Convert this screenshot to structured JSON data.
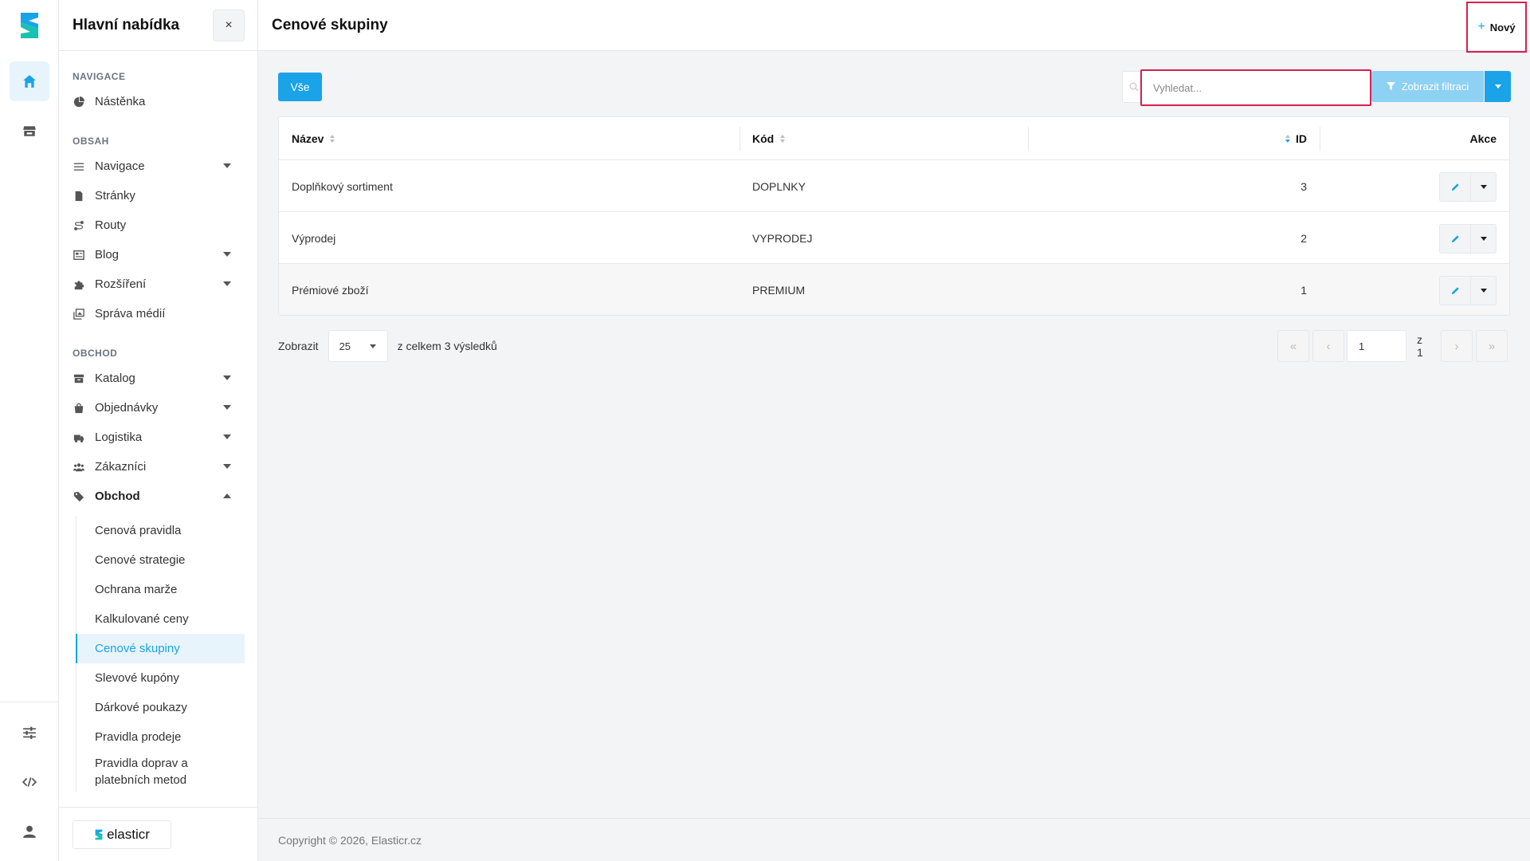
{
  "sidebar": {
    "title": "Hlavní nabídka",
    "close_label": "×",
    "sections": {
      "navigace": "NAVIGACE",
      "obsah": "OBSAH",
      "obchod": "OBCHOD"
    },
    "items": {
      "nastenka": "Nástěnka",
      "navigace": "Navigace",
      "stranky": "Stránky",
      "routy": "Routy",
      "blog": "Blog",
      "rozsireni": "Rozšíření",
      "sprava_medii": "Správa médií",
      "katalog": "Katalog",
      "objednavky": "Objednávky",
      "logistika": "Logistika",
      "zakaznici": "Zákazníci",
      "obchod": "Obchod"
    },
    "submenu": [
      "Cenová pravidla",
      "Cenové strategie",
      "Ochrana marže",
      "Kalkulované ceny",
      "Cenové skupiny",
      "Slevové kupóny",
      "Dárkové poukazy",
      "Pravidla prodeje",
      "Pravidla doprav a platebních metod"
    ],
    "brand": "elasticr"
  },
  "header": {
    "title": "Cenové skupiny",
    "new_label": "Nový",
    "new_icon": "+"
  },
  "toolbar": {
    "all_label": "Vše",
    "search_placeholder": "Vyhledat...",
    "filter_label": "Zobrazit filtraci"
  },
  "table": {
    "columns": {
      "name": "Název",
      "code": "Kód",
      "id": "ID",
      "actions": "Akce"
    },
    "rows": [
      {
        "name": "Doplňkový sortiment",
        "code": "DOPLNKY",
        "id": "3"
      },
      {
        "name": "Výprodej",
        "code": "VYPRODEJ",
        "id": "2"
      },
      {
        "name": "Prémiové zboží",
        "code": "PREMIUM",
        "id": "1"
      }
    ]
  },
  "pagination": {
    "show_label": "Zobrazit",
    "per_page": "25",
    "total_text": "z celkem 3 výsledků",
    "first": "«",
    "prev": "‹",
    "next": "›",
    "last": "»",
    "current_page": "1",
    "of_pages": "z 1"
  },
  "footer": {
    "copyright": "Copyright © 2026, Elasticr.cz"
  },
  "colors": {
    "accent": "#1aa3e8",
    "highlight_box": "#d6204f",
    "logo_teal": "#19c2b1"
  }
}
